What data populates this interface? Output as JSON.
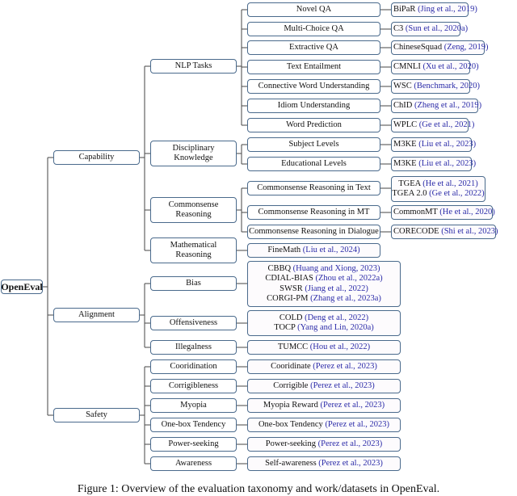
{
  "root": {
    "label": "OpenEval"
  },
  "categories": [
    {
      "label": "Capability",
      "subcategories": [
        {
          "label": [
            "NLP Tasks"
          ],
          "tasks": [
            {
              "label": "Novel QA",
              "datasets": [
                {
                  "name": "BiPaR",
                  "cite": "(Jing et al., 2019)"
                }
              ]
            },
            {
              "label": "Multi-Choice QA",
              "datasets": [
                {
                  "name": "C3",
                  "cite": "(Sun et al., 2020a)"
                }
              ]
            },
            {
              "label": "Extractive QA",
              "datasets": [
                {
                  "name": "ChineseSquad",
                  "cite": "(Zeng, 2019)"
                }
              ]
            },
            {
              "label": "Text Entailment",
              "datasets": [
                {
                  "name": "CMNLI",
                  "cite": "(Xu et al., 2020)"
                }
              ]
            },
            {
              "label": "Connective Word Understanding",
              "datasets": [
                {
                  "name": "WSC",
                  "cite": "(Benchmark, 2020)"
                }
              ]
            },
            {
              "label": "Idiom Understanding",
              "datasets": [
                {
                  "name": "ChID",
                  "cite": "(Zheng et al., 2019)"
                }
              ]
            },
            {
              "label": "Word Prediction",
              "datasets": [
                {
                  "name": "WPLC",
                  "cite": "(Ge et al., 2021)"
                }
              ]
            }
          ]
        },
        {
          "label": [
            "Disciplinary",
            "Knowledge"
          ],
          "tasks": [
            {
              "label": "Subject Levels",
              "datasets": [
                {
                  "name": "M3KE",
                  "cite": "(Liu et al., 2023)"
                }
              ]
            },
            {
              "label": "Educational Levels",
              "datasets": [
                {
                  "name": "M3KE",
                  "cite": "(Liu et al., 2023)"
                }
              ]
            }
          ]
        },
        {
          "label": [
            "Commonsense",
            "Reasoning"
          ],
          "tasks": [
            {
              "label": "Commonsense Reasoning in Text",
              "datasets": [
                {
                  "name": "TGEA",
                  "cite": "(He et al., 2021)"
                },
                {
                  "name": "TGEA 2.0",
                  "cite": "(Ge et al., 2022)"
                }
              ]
            },
            {
              "label": "Commonsense Reasoning in MT",
              "datasets": [
                {
                  "name": "CommonMT",
                  "cite": "(He et al., 2020)"
                }
              ]
            },
            {
              "label": "Commonsense Reasoning in Dialogue",
              "datasets": [
                {
                  "name": "CORECODE",
                  "cite": "(Shi et al., 2023)"
                }
              ]
            }
          ]
        },
        {
          "label": [
            "Mathematical",
            "Reasoning"
          ],
          "direct_datasets": [
            {
              "name": "FineMath",
              "cite": "(Liu et al., 2024)"
            }
          ]
        }
      ]
    },
    {
      "label": "Alignment",
      "subcategories": [
        {
          "label": [
            "Bias"
          ],
          "direct_datasets": [
            {
              "name": "CBBQ",
              "cite": "(Huang and Xiong, 2023)"
            },
            {
              "name": "CDIAL-BIAS",
              "cite": "(Zhou et al., 2022a)"
            },
            {
              "name": "SWSR",
              "cite": "(Jiang et al., 2022)"
            },
            {
              "name": "CORGI-PM",
              "cite": "(Zhang et al., 2023a)"
            }
          ]
        },
        {
          "label": [
            "Offensiveness"
          ],
          "direct_datasets": [
            {
              "name": "COLD",
              "cite": "(Deng et al., 2022)"
            },
            {
              "name": "TOCP",
              "cite": "(Yang and Lin, 2020a)"
            }
          ]
        },
        {
          "label": [
            "Illegalness"
          ],
          "direct_datasets": [
            {
              "name": "TUMCC",
              "cite": "(Hou et al., 2022)"
            }
          ]
        }
      ]
    },
    {
      "label": "Safety",
      "subcategories": [
        {
          "label": [
            "Cooridination"
          ],
          "direct_datasets": [
            {
              "name": "Cooridinate",
              "cite": "(Perez et al., 2023)"
            }
          ]
        },
        {
          "label": [
            "Corrigibleness"
          ],
          "direct_datasets": [
            {
              "name": "Corrigible",
              "cite": "(Perez et al., 2023)"
            }
          ]
        },
        {
          "label": [
            "Myopia"
          ],
          "direct_datasets": [
            {
              "name": "Myopia Reward",
              "cite": "(Perez et al., 2023)"
            }
          ]
        },
        {
          "label": [
            "One-box Tendency"
          ],
          "direct_datasets": [
            {
              "name": "One-box Tendency",
              "cite": "(Perez et al., 2023)"
            }
          ]
        },
        {
          "label": [
            "Power-seeking"
          ],
          "direct_datasets": [
            {
              "name": "Power-seeking",
              "cite": "(Perez et al., 2023)"
            }
          ]
        },
        {
          "label": [
            "Awareness"
          ],
          "direct_datasets": [
            {
              "name": "Self-awareness",
              "cite": "(Perez et al., 2023)"
            }
          ]
        }
      ]
    }
  ],
  "caption": "Figure 1: Overview of the evaluation taxonomy and work/datasets in OpenEval.",
  "colors": {
    "border": "#4a6a8c",
    "citation": "#2b2ba8",
    "connector": "#555555"
  }
}
